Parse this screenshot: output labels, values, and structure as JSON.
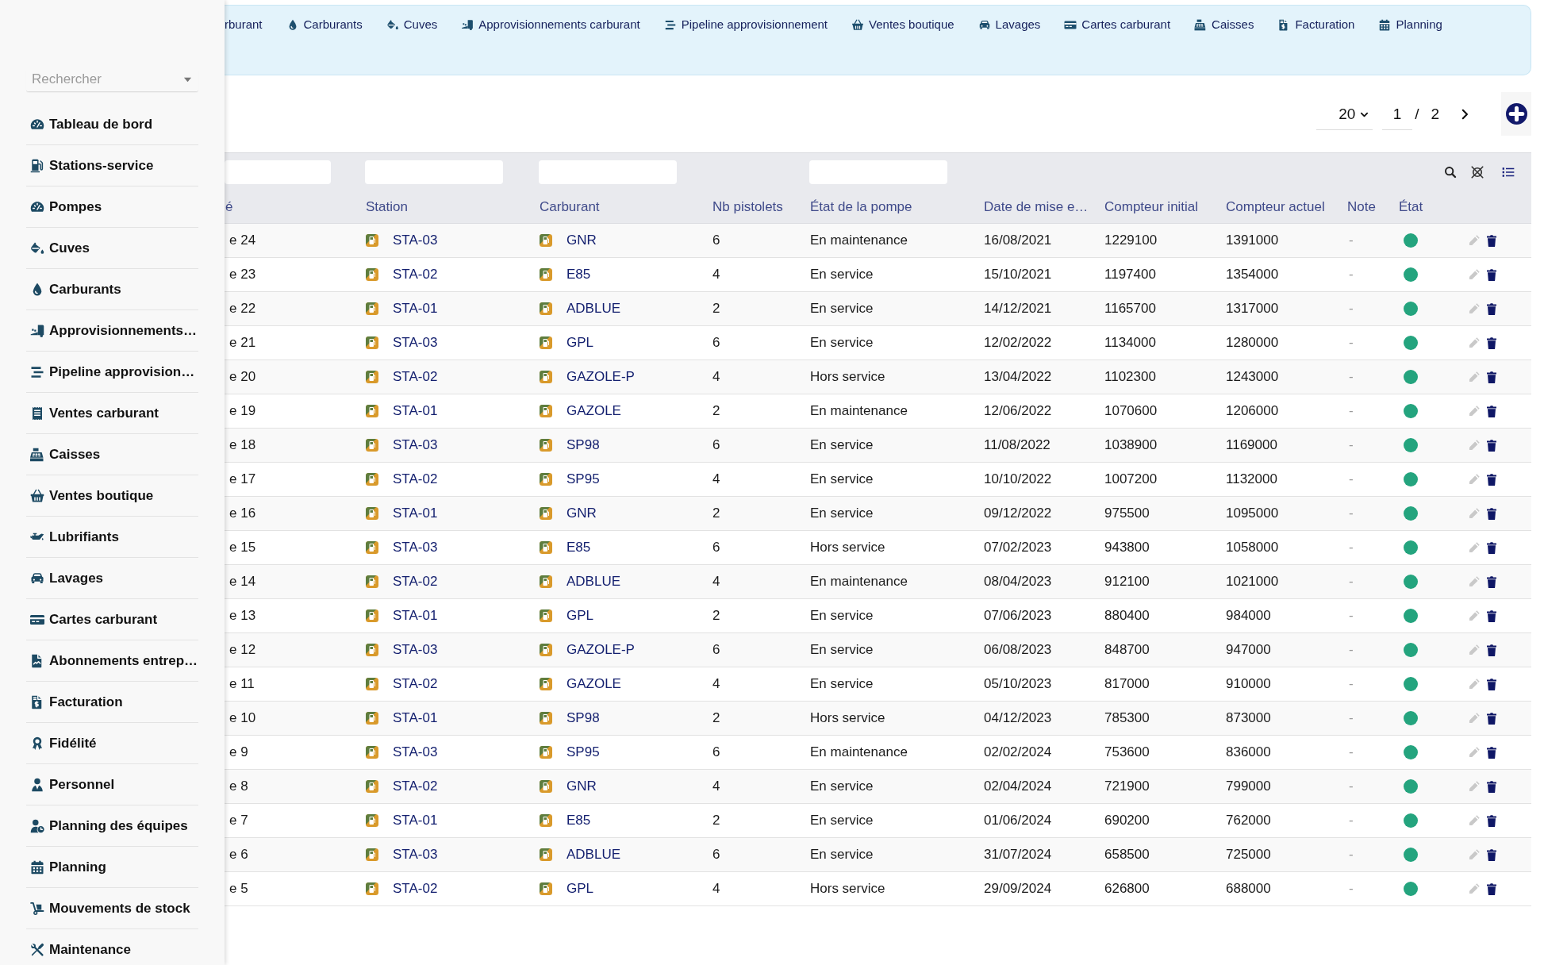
{
  "sidebar": {
    "search": {
      "placeholder": "Rechercher"
    },
    "items": [
      {
        "label": "Tableau de bord"
      },
      {
        "label": "Stations-service"
      },
      {
        "label": "Pompes"
      },
      {
        "label": "Cuves"
      },
      {
        "label": "Carburants"
      },
      {
        "label": "Approvisionnements…"
      },
      {
        "label": "Pipeline approvision…"
      },
      {
        "label": "Ventes carburant"
      },
      {
        "label": "Caisses"
      },
      {
        "label": "Ventes boutique"
      },
      {
        "label": "Lubrifiants"
      },
      {
        "label": "Lavages"
      },
      {
        "label": "Cartes carburant"
      },
      {
        "label": "Abonnements entrep…"
      },
      {
        "label": "Facturation"
      },
      {
        "label": "Fidélité"
      },
      {
        "label": "Personnel"
      },
      {
        "label": "Planning des équipes"
      },
      {
        "label": "Planning"
      },
      {
        "label": "Mouvements de stock"
      },
      {
        "label": "Maintenance"
      }
    ]
  },
  "top_nav": {
    "items": [
      {
        "label": "rburant"
      },
      {
        "label": "Carburants"
      },
      {
        "label": "Cuves"
      },
      {
        "label": "Approvisionnements carburant"
      },
      {
        "label": "Pipeline approvisionnement"
      },
      {
        "label": "Ventes boutique"
      },
      {
        "label": "Lavages"
      },
      {
        "label": "Cartes carburant"
      },
      {
        "label": "Caisses"
      },
      {
        "label": "Facturation"
      },
      {
        "label": "Planning"
      }
    ]
  },
  "pagination": {
    "page_size": "20",
    "page": "1",
    "separator": "/",
    "page_count": "2"
  },
  "table": {
    "columns": [
      "é",
      "Station",
      "Carburant",
      "Nb pistolets",
      "État de la pompe",
      "Date de mise e…",
      "Compteur initial",
      "Compteur actuel",
      "Note",
      "État"
    ],
    "rows": [
      {
        "column_1": "e 24",
        "station": "STA-03",
        "carburant": "GNR",
        "nb_pistolets": "6",
        "etat_pompe": "En maintenance",
        "date": "16/08/2021",
        "compteur_initial": "1229100",
        "compteur_actuel": "1391000",
        "note": "-",
        "color": "#24a47e"
      },
      {
        "column_1": "e 23",
        "station": "STA-02",
        "carburant": "E85",
        "nb_pistolets": "4",
        "etat_pompe": "En service",
        "date": "15/10/2021",
        "compteur_initial": "1197400",
        "compteur_actuel": "1354000",
        "note": "-",
        "color": "#24a47e"
      },
      {
        "column_1": "e 22",
        "station": "STA-01",
        "carburant": "ADBLUE",
        "nb_pistolets": "2",
        "etat_pompe": "En service",
        "date": "14/12/2021",
        "compteur_initial": "1165700",
        "compteur_actuel": "1317000",
        "note": "-",
        "color": "#24a47e"
      },
      {
        "column_1": "e 21",
        "station": "STA-03",
        "carburant": "GPL",
        "nb_pistolets": "6",
        "etat_pompe": "En service",
        "date": "12/02/2022",
        "compteur_initial": "1134000",
        "compteur_actuel": "1280000",
        "note": "-",
        "color": "#24a47e"
      },
      {
        "column_1": "e 20",
        "station": "STA-02",
        "carburant": "GAZOLE-P",
        "nb_pistolets": "4",
        "etat_pompe": "Hors service",
        "date": "13/04/2022",
        "compteur_initial": "1102300",
        "compteur_actuel": "1243000",
        "note": "-",
        "color": "#24a47e"
      },
      {
        "column_1": "e 19",
        "station": "STA-01",
        "carburant": "GAZOLE",
        "nb_pistolets": "2",
        "etat_pompe": "En maintenance",
        "date": "12/06/2022",
        "compteur_initial": "1070600",
        "compteur_actuel": "1206000",
        "note": "-",
        "color": "#24a47e"
      },
      {
        "column_1": "e 18",
        "station": "STA-03",
        "carburant": "SP98",
        "nb_pistolets": "6",
        "etat_pompe": "En service",
        "date": "11/08/2022",
        "compteur_initial": "1038900",
        "compteur_actuel": "1169000",
        "note": "-",
        "color": "#24a47e"
      },
      {
        "column_1": "e 17",
        "station": "STA-02",
        "carburant": "SP95",
        "nb_pistolets": "4",
        "etat_pompe": "En service",
        "date": "10/10/2022",
        "compteur_initial": "1007200",
        "compteur_actuel": "1132000",
        "note": "-",
        "color": "#24a47e"
      },
      {
        "column_1": "e 16",
        "station": "STA-01",
        "carburant": "GNR",
        "nb_pistolets": "2",
        "etat_pompe": "En service",
        "date": "09/12/2022",
        "compteur_initial": "975500",
        "compteur_actuel": "1095000",
        "note": "-",
        "color": "#24a47e"
      },
      {
        "column_1": "e 15",
        "station": "STA-03",
        "carburant": "E85",
        "nb_pistolets": "6",
        "etat_pompe": "Hors service",
        "date": "07/02/2023",
        "compteur_initial": "943800",
        "compteur_actuel": "1058000",
        "note": "-",
        "color": "#24a47e"
      },
      {
        "column_1": "e 14",
        "station": "STA-02",
        "carburant": "ADBLUE",
        "nb_pistolets": "4",
        "etat_pompe": "En maintenance",
        "date": "08/04/2023",
        "compteur_initial": "912100",
        "compteur_actuel": "1021000",
        "note": "-",
        "color": "#24a47e"
      },
      {
        "column_1": "e 13",
        "station": "STA-01",
        "carburant": "GPL",
        "nb_pistolets": "2",
        "etat_pompe": "En service",
        "date": "07/06/2023",
        "compteur_initial": "880400",
        "compteur_actuel": "984000",
        "note": "-",
        "color": "#24a47e"
      },
      {
        "column_1": "e 12",
        "station": "STA-03",
        "carburant": "GAZOLE-P",
        "nb_pistolets": "6",
        "etat_pompe": "En service",
        "date": "06/08/2023",
        "compteur_initial": "848700",
        "compteur_actuel": "947000",
        "note": "-",
        "color": "#24a47e"
      },
      {
        "column_1": "e 11",
        "station": "STA-02",
        "carburant": "GAZOLE",
        "nb_pistolets": "4",
        "etat_pompe": "En service",
        "date": "05/10/2023",
        "compteur_initial": "817000",
        "compteur_actuel": "910000",
        "note": "-",
        "color": "#24a47e"
      },
      {
        "column_1": "e 10",
        "station": "STA-01",
        "carburant": "SP98",
        "nb_pistolets": "2",
        "etat_pompe": "Hors service",
        "date": "04/12/2023",
        "compteur_initial": "785300",
        "compteur_actuel": "873000",
        "note": "-",
        "color": "#24a47e"
      },
      {
        "column_1": "e 9",
        "station": "STA-03",
        "carburant": "SP95",
        "nb_pistolets": "6",
        "etat_pompe": "En maintenance",
        "date": "02/02/2024",
        "compteur_initial": "753600",
        "compteur_actuel": "836000",
        "note": "-",
        "color": "#24a47e"
      },
      {
        "column_1": "e 8",
        "station": "STA-02",
        "carburant": "GNR",
        "nb_pistolets": "4",
        "etat_pompe": "En service",
        "date": "02/04/2024",
        "compteur_initial": "721900",
        "compteur_actuel": "799000",
        "note": "-",
        "color": "#24a47e"
      },
      {
        "column_1": "e 7",
        "station": "STA-01",
        "carburant": "E85",
        "nb_pistolets": "2",
        "etat_pompe": "En service",
        "date": "01/06/2024",
        "compteur_initial": "690200",
        "compteur_actuel": "762000",
        "note": "-",
        "color": "#24a47e"
      },
      {
        "column_1": "e 6",
        "station": "STA-03",
        "carburant": "ADBLUE",
        "nb_pistolets": "6",
        "etat_pompe": "En service",
        "date": "31/07/2024",
        "compteur_initial": "658500",
        "compteur_actuel": "725000",
        "note": "-",
        "color": "#24a47e"
      },
      {
        "column_1": "e 5",
        "station": "STA-02",
        "carburant": "GPL",
        "nb_pistolets": "4",
        "etat_pompe": "Hors service",
        "date": "29/09/2024",
        "compteur_initial": "626800",
        "compteur_actuel": "688000",
        "note": "-",
        "color": "#24a47e"
      }
    ]
  }
}
